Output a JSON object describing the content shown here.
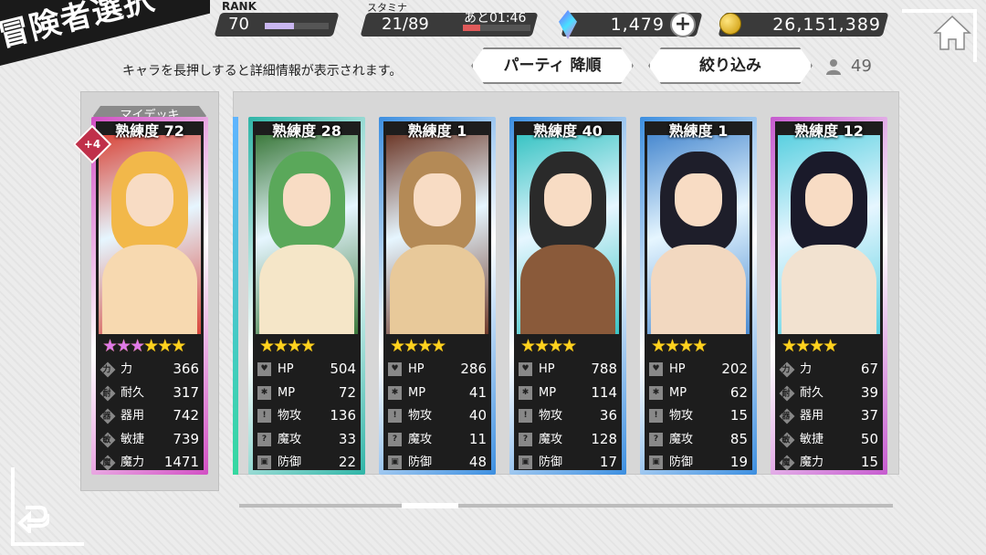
{
  "header": {
    "title": "冒険者選択",
    "hint": "キャラを長押しすると詳細情報が表示されます。"
  },
  "status": {
    "rank_label": "RANK",
    "rank": "70",
    "rank_progress": 0.45,
    "stamina_label": "スタミナ",
    "stamina": "21/89",
    "stamina_timer": "あと01:46",
    "stamina_progress": 0.25,
    "gems": "1,479",
    "gold": "26,151,389"
  },
  "controls": {
    "sort_label": "パーティ 降順",
    "filter_label": "絞り込み",
    "member_count": "49"
  },
  "deck": {
    "label": "マイデッキ",
    "badge": "+4"
  },
  "cards": [
    {
      "proficiency": "熟練度 72",
      "frame": "#d24fc4",
      "pink_stars": 3,
      "gold_stars": 3,
      "stats": [
        {
          "icon": "力",
          "name": "力",
          "value": "366"
        },
        {
          "icon": "耐",
          "name": "耐久",
          "value": "317"
        },
        {
          "icon": "器",
          "name": "器用",
          "value": "742"
        },
        {
          "icon": "敏",
          "name": "敏捷",
          "value": "739"
        },
        {
          "icon": "魔",
          "name": "魔力",
          "value": "1471"
        }
      ]
    },
    {
      "proficiency": "熟練度 28",
      "frame": "#2fb5a7",
      "pink_stars": 0,
      "gold_stars": 4,
      "stats": [
        {
          "icon": "♥",
          "name": "HP",
          "value": "504"
        },
        {
          "icon": "✱",
          "name": "MP",
          "value": "72"
        },
        {
          "icon": "!",
          "name": "物攻",
          "value": "136"
        },
        {
          "icon": "?",
          "name": "魔攻",
          "value": "33"
        },
        {
          "icon": "▣",
          "name": "防御",
          "value": "22"
        }
      ]
    },
    {
      "proficiency": "熟練度 1",
      "frame": "#3d8fe0",
      "pink_stars": 0,
      "gold_stars": 4,
      "stats": [
        {
          "icon": "♥",
          "name": "HP",
          "value": "286"
        },
        {
          "icon": "✱",
          "name": "MP",
          "value": "41"
        },
        {
          "icon": "!",
          "name": "物攻",
          "value": "40"
        },
        {
          "icon": "?",
          "name": "魔攻",
          "value": "11"
        },
        {
          "icon": "▣",
          "name": "防御",
          "value": "48"
        }
      ]
    },
    {
      "proficiency": "熟練度 40",
      "frame": "#3d8fe0",
      "pink_stars": 0,
      "gold_stars": 4,
      "stats": [
        {
          "icon": "♥",
          "name": "HP",
          "value": "788"
        },
        {
          "icon": "✱",
          "name": "MP",
          "value": "114"
        },
        {
          "icon": "!",
          "name": "物攻",
          "value": "36"
        },
        {
          "icon": "?",
          "name": "魔攻",
          "value": "128"
        },
        {
          "icon": "▣",
          "name": "防御",
          "value": "17"
        }
      ]
    },
    {
      "proficiency": "熟練度 1",
      "frame": "#3d8fe0",
      "pink_stars": 0,
      "gold_stars": 4,
      "stats": [
        {
          "icon": "♥",
          "name": "HP",
          "value": "202"
        },
        {
          "icon": "✱",
          "name": "MP",
          "value": "62"
        },
        {
          "icon": "!",
          "name": "物攻",
          "value": "15"
        },
        {
          "icon": "?",
          "name": "魔攻",
          "value": "85"
        },
        {
          "icon": "▣",
          "name": "防御",
          "value": "19"
        }
      ]
    },
    {
      "proficiency": "熟練度 12",
      "frame": "#c65bcf",
      "pink_stars": 0,
      "gold_stars": 4,
      "stats": [
        {
          "icon": "力",
          "name": "力",
          "value": "67"
        },
        {
          "icon": "耐",
          "name": "耐久",
          "value": "39"
        },
        {
          "icon": "器",
          "name": "器用",
          "value": "37"
        },
        {
          "icon": "敏",
          "name": "敏捷",
          "value": "50"
        },
        {
          "icon": "魔",
          "name": "魔力",
          "value": "15"
        }
      ]
    }
  ]
}
